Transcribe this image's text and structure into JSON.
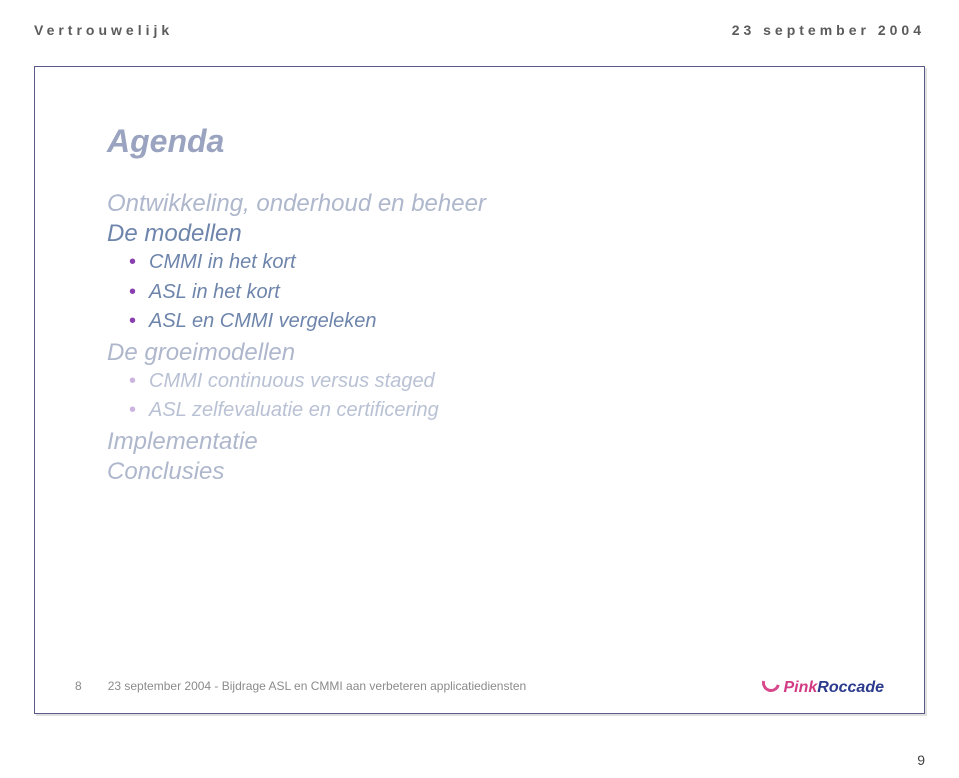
{
  "header": {
    "left": "Vertrouwelijk",
    "right": "23 september 2004"
  },
  "slide": {
    "title": "Agenda",
    "section1": {
      "label": "Ontwikkeling, onderhoud en beheer"
    },
    "section2": {
      "label": "De modellen"
    },
    "bullets_models": [
      "CMMI in het kort",
      "ASL in het kort",
      "ASL en CMMI vergeleken"
    ],
    "section3": {
      "label": "De groeimodellen"
    },
    "bullets_groei": [
      "CMMI continuous versus staged",
      "ASL zelfevaluatie en certificering"
    ],
    "section4": {
      "label": "Implementatie"
    },
    "section5": {
      "label": "Conclusies"
    },
    "footer": {
      "page_in_deck": "8",
      "caption": "23 september 2004 - Bijdrage ASL en CMMI aan verbeteren applicatiediensten"
    },
    "logo": {
      "pink": "Pink",
      "roccade": "Roccade"
    }
  },
  "page_number": "9"
}
